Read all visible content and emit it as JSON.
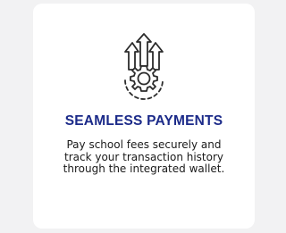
{
  "card": {
    "icon": "gear-with-upward-arrows-icon",
    "title": "SEAMLESS PAYMENTS",
    "description_lines": [
      "Pay school fees securely and",
      "track your transaction history",
      "through the integrated wallet."
    ]
  },
  "colors": {
    "background": "#f2f2f3",
    "card": "#ffffff",
    "title": "#1b2a89",
    "icon": "#2b2b2b"
  }
}
